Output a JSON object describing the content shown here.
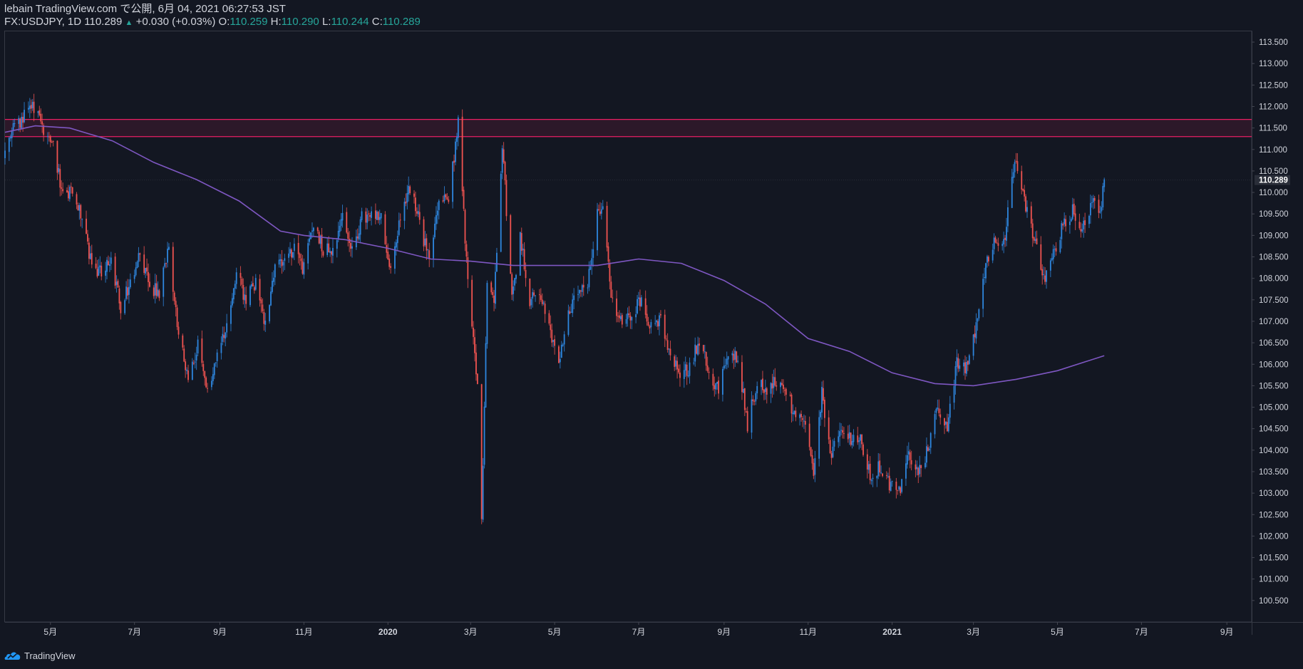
{
  "header": {
    "publish_line": "lebain TradingView.com で公開, 6月 04, 2021 06:27:53 JST",
    "symbol_line": "FX:USDJPY, 1D 110.289",
    "change": "+0.030 (+0.03%)",
    "o_label": "O:",
    "o_value": "110.259",
    "h_label": "H:",
    "h_value": "110.290",
    "l_label": "L:",
    "l_value": "110.244",
    "c_label": "C:",
    "c_value": "110.289"
  },
  "footer": {
    "brand": "TradingView"
  },
  "colors": {
    "background": "#131722",
    "up": "#2e86de",
    "down": "#ef5350",
    "ma": "#7e57c2",
    "zone": "#e91e63",
    "text": "#d1d4dc"
  },
  "chart_data": {
    "type": "candlestick",
    "symbol": "FX:USDJPY",
    "timeframe": "1D",
    "last_price": "110.289",
    "ylim": [
      100.0,
      113.75
    ],
    "y_ticks": [
      "113.500",
      "113.000",
      "112.500",
      "112.000",
      "111.500",
      "111.000",
      "110.500",
      "110.000",
      "109.500",
      "109.000",
      "108.500",
      "108.000",
      "107.500",
      "107.000",
      "106.500",
      "106.000",
      "105.500",
      "105.000",
      "104.500",
      "104.000",
      "103.500",
      "103.000",
      "102.500",
      "102.000",
      "101.500",
      "101.000",
      "100.500"
    ],
    "x_ticks": [
      {
        "label": "5月",
        "date": "2019-05-01"
      },
      {
        "label": "7月",
        "date": "2019-07-01"
      },
      {
        "label": "9月",
        "date": "2019-09-01"
      },
      {
        "label": "11月",
        "date": "2019-11-01"
      },
      {
        "label": "2020",
        "date": "2020-01-01"
      },
      {
        "label": "3月",
        "date": "2020-03-01"
      },
      {
        "label": "5月",
        "date": "2020-05-01"
      },
      {
        "label": "7月",
        "date": "2020-07-01"
      },
      {
        "label": "9月",
        "date": "2020-09-01"
      },
      {
        "label": "11月",
        "date": "2020-11-01"
      },
      {
        "label": "2021",
        "date": "2021-01-01"
      },
      {
        "label": "3月",
        "date": "2021-03-01"
      },
      {
        "label": "5月",
        "date": "2021-05-01"
      },
      {
        "label": "7月",
        "date": "2021-07-01"
      },
      {
        "label": "9月",
        "date": "2021-09-01"
      }
    ],
    "start_date": "2019-03-29",
    "end_date": "2021-09-19",
    "resistance_zone": [
      111.3,
      111.7
    ],
    "close_path": [
      [
        "2019-03-29",
        110.8
      ],
      [
        "2019-04-04",
        111.5
      ],
      [
        "2019-04-10",
        111.7
      ],
      [
        "2019-04-16",
        111.9
      ],
      [
        "2019-04-22",
        112.0
      ],
      [
        "2019-04-26",
        111.5
      ],
      [
        "2019-05-03",
        111.1
      ],
      [
        "2019-05-10",
        109.9
      ],
      [
        "2019-05-17",
        110.1
      ],
      [
        "2019-05-24",
        109.4
      ],
      [
        "2019-05-31",
        108.3
      ],
      [
        "2019-06-07",
        108.1
      ],
      [
        "2019-06-14",
        108.5
      ],
      [
        "2019-06-21",
        107.3
      ],
      [
        "2019-06-28",
        107.9
      ],
      [
        "2019-07-05",
        108.5
      ],
      [
        "2019-07-12",
        107.8
      ],
      [
        "2019-07-19",
        107.7
      ],
      [
        "2019-07-26",
        108.7
      ],
      [
        "2019-08-02",
        106.6
      ],
      [
        "2019-08-09",
        105.7
      ],
      [
        "2019-08-16",
        106.4
      ],
      [
        "2019-08-23",
        105.4
      ],
      [
        "2019-08-30",
        106.3
      ],
      [
        "2019-09-06",
        106.9
      ],
      [
        "2019-09-13",
        108.1
      ],
      [
        "2019-09-20",
        107.5
      ],
      [
        "2019-09-27",
        107.9
      ],
      [
        "2019-10-04",
        106.9
      ],
      [
        "2019-10-11",
        108.3
      ],
      [
        "2019-10-18",
        108.5
      ],
      [
        "2019-10-25",
        108.7
      ],
      [
        "2019-11-01",
        108.2
      ],
      [
        "2019-11-08",
        109.3
      ],
      [
        "2019-11-15",
        108.7
      ],
      [
        "2019-11-22",
        108.7
      ],
      [
        "2019-11-29",
        109.5
      ],
      [
        "2019-12-06",
        108.6
      ],
      [
        "2019-12-13",
        109.4
      ],
      [
        "2019-12-20",
        109.4
      ],
      [
        "2019-12-27",
        109.4
      ],
      [
        "2020-01-03",
        108.1
      ],
      [
        "2020-01-10",
        109.5
      ],
      [
        "2020-01-17",
        110.1
      ],
      [
        "2020-01-24",
        109.3
      ],
      [
        "2020-01-31",
        108.4
      ],
      [
        "2020-02-07",
        109.8
      ],
      [
        "2020-02-14",
        109.8
      ],
      [
        "2020-02-21",
        111.6
      ],
      [
        "2020-02-28",
        107.9
      ],
      [
        "2020-03-06",
        105.4
      ],
      [
        "2020-03-09",
        102.4
      ],
      [
        "2020-03-13",
        107.9
      ],
      [
        "2020-03-18",
        107.5
      ],
      [
        "2020-03-24",
        111.2
      ],
      [
        "2020-03-31",
        107.5
      ],
      [
        "2020-04-06",
        109.0
      ],
      [
        "2020-04-13",
        107.5
      ],
      [
        "2020-04-20",
        107.7
      ],
      [
        "2020-04-27",
        106.8
      ],
      [
        "2020-05-04",
        106.1
      ],
      [
        "2020-05-11",
        107.2
      ],
      [
        "2020-05-18",
        107.6
      ],
      [
        "2020-05-25",
        107.8
      ],
      [
        "2020-06-01",
        109.6
      ],
      [
        "2020-06-05",
        109.6
      ],
      [
        "2020-06-12",
        107.4
      ],
      [
        "2020-06-19",
        106.9
      ],
      [
        "2020-06-26",
        107.2
      ],
      [
        "2020-07-03",
        107.5
      ],
      [
        "2020-07-10",
        106.9
      ],
      [
        "2020-07-17",
        107.0
      ],
      [
        "2020-07-24",
        106.1
      ],
      [
        "2020-07-31",
        105.8
      ],
      [
        "2020-08-07",
        105.9
      ],
      [
        "2020-08-14",
        106.6
      ],
      [
        "2020-08-21",
        105.8
      ],
      [
        "2020-08-28",
        105.4
      ],
      [
        "2020-09-04",
        106.2
      ],
      [
        "2020-09-11",
        106.2
      ],
      [
        "2020-09-18",
        104.6
      ],
      [
        "2020-09-25",
        105.6
      ],
      [
        "2020-10-02",
        105.4
      ],
      [
        "2020-10-09",
        105.6
      ],
      [
        "2020-10-16",
        105.4
      ],
      [
        "2020-10-23",
        104.7
      ],
      [
        "2020-10-30",
        104.6
      ],
      [
        "2020-11-05",
        103.4
      ],
      [
        "2020-11-11",
        105.3
      ],
      [
        "2020-11-18",
        103.9
      ],
      [
        "2020-11-25",
        104.4
      ],
      [
        "2020-12-02",
        104.3
      ],
      [
        "2020-12-09",
        104.2
      ],
      [
        "2020-12-16",
        103.4
      ],
      [
        "2020-12-23",
        103.6
      ],
      [
        "2020-12-30",
        103.2
      ],
      [
        "2021-01-06",
        103.0
      ],
      [
        "2021-01-13",
        103.9
      ],
      [
        "2021-01-20",
        103.5
      ],
      [
        "2021-01-27",
        104.0
      ],
      [
        "2021-02-03",
        105.0
      ],
      [
        "2021-02-10",
        104.6
      ],
      [
        "2021-02-17",
        106.0
      ],
      [
        "2021-02-24",
        105.9
      ],
      [
        "2021-03-03",
        106.9
      ],
      [
        "2021-03-10",
        108.4
      ],
      [
        "2021-03-17",
        108.9
      ],
      [
        "2021-03-24",
        109.0
      ],
      [
        "2021-03-31",
        110.7
      ],
      [
        "2021-04-07",
        109.8
      ],
      [
        "2021-04-14",
        108.9
      ],
      [
        "2021-04-21",
        108.0
      ],
      [
        "2021-04-28",
        108.6
      ],
      [
        "2021-05-05",
        109.2
      ],
      [
        "2021-05-12",
        109.6
      ],
      [
        "2021-05-19",
        109.2
      ],
      [
        "2021-05-26",
        109.8
      ],
      [
        "2021-06-01",
        109.6
      ],
      [
        "2021-06-04",
        110.289
      ]
    ],
    "ma_path": [
      [
        "2019-03-29",
        111.4
      ],
      [
        "2019-04-20",
        111.55
      ],
      [
        "2019-05-15",
        111.5
      ],
      [
        "2019-06-15",
        111.2
      ],
      [
        "2019-07-15",
        110.7
      ],
      [
        "2019-08-15",
        110.3
      ],
      [
        "2019-09-15",
        109.8
      ],
      [
        "2019-10-15",
        109.1
      ],
      [
        "2019-11-01",
        109.0
      ],
      [
        "2019-12-01",
        108.9
      ],
      [
        "2020-01-01",
        108.7
      ],
      [
        "2020-02-01",
        108.45
      ],
      [
        "2020-03-01",
        108.4
      ],
      [
        "2020-04-01",
        108.3
      ],
      [
        "2020-05-01",
        108.3
      ],
      [
        "2020-06-01",
        108.3
      ],
      [
        "2020-07-01",
        108.45
      ],
      [
        "2020-08-01",
        108.35
      ],
      [
        "2020-09-01",
        107.95
      ],
      [
        "2020-10-01",
        107.4
      ],
      [
        "2020-11-01",
        106.6
      ],
      [
        "2020-12-01",
        106.3
      ],
      [
        "2021-01-01",
        105.8
      ],
      [
        "2021-02-01",
        105.55
      ],
      [
        "2021-03-01",
        105.5
      ],
      [
        "2021-04-01",
        105.65
      ],
      [
        "2021-05-01",
        105.85
      ],
      [
        "2021-06-04",
        106.2
      ]
    ]
  }
}
